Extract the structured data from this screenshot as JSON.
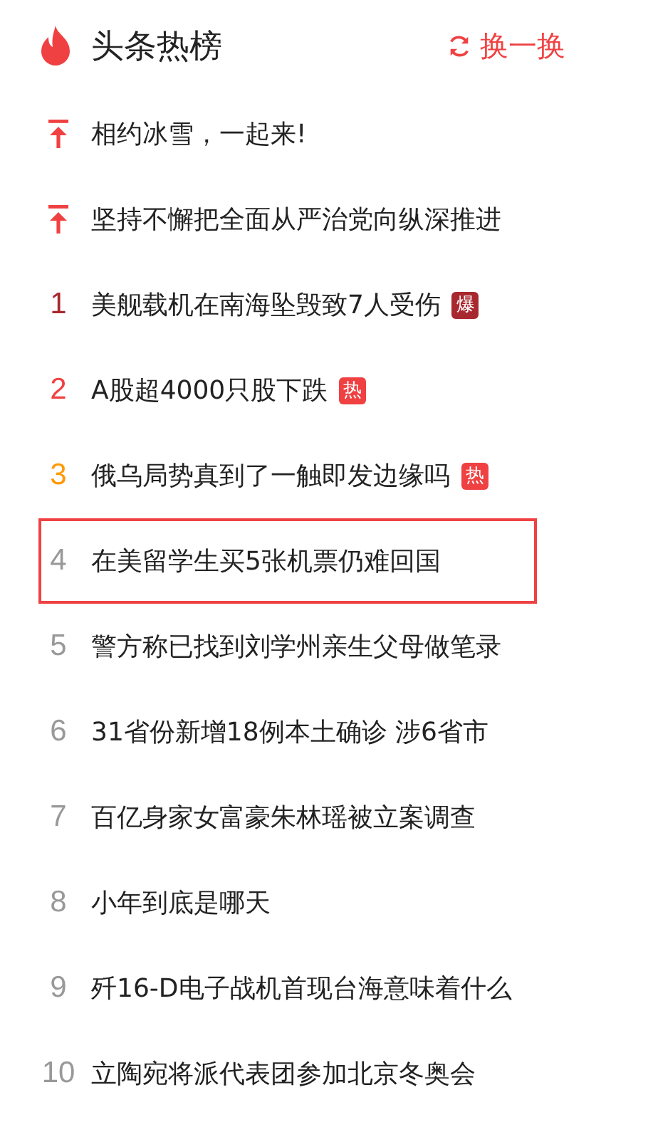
{
  "header": {
    "title": "头条热榜",
    "refresh": "换一换"
  },
  "items": [
    {
      "kind": "pinned",
      "text": "相约冰雪，一起来!",
      "selected": false
    },
    {
      "kind": "pinned",
      "text": "坚持不懈把全面从严治党向纵深推进",
      "selected": false
    },
    {
      "kind": "ranked",
      "rank": "1",
      "color": "#a8282f",
      "text": "美舰载机在南海坠毁致7人受伤",
      "badge": {
        "text": "爆",
        "color": "#a8282f"
      },
      "selected": false
    },
    {
      "kind": "ranked",
      "rank": "2",
      "color": "#f04142",
      "text": "A股超4000只股下跌",
      "badge": {
        "text": "热",
        "color": "#f04142"
      },
      "selected": false
    },
    {
      "kind": "ranked",
      "rank": "3",
      "color": "#fe9900",
      "text": "俄乌局势真到了一触即发边缘吗",
      "badge": {
        "text": "热",
        "color": "#f04142"
      },
      "selected": false
    },
    {
      "kind": "ranked",
      "rank": "4",
      "color": "#999999",
      "text": "在美留学生买5张机票仍难回国",
      "selected": true
    },
    {
      "kind": "ranked",
      "rank": "5",
      "color": "#999999",
      "text": "警方称已找到刘学州亲生父母做笔录",
      "selected": false
    },
    {
      "kind": "ranked",
      "rank": "6",
      "color": "#999999",
      "text": "31省份新增18例本土确诊 涉6省市",
      "selected": false
    },
    {
      "kind": "ranked",
      "rank": "7",
      "color": "#999999",
      "text": "百亿身家女富豪朱林瑶被立案调查",
      "selected": false
    },
    {
      "kind": "ranked",
      "rank": "8",
      "color": "#999999",
      "text": "小年到底是哪天",
      "selected": false
    },
    {
      "kind": "ranked",
      "rank": "9",
      "color": "#999999",
      "text": "歼16-D电子战机首现台海意味着什么",
      "selected": false
    },
    {
      "kind": "ranked",
      "rank": "10",
      "color": "#999999",
      "text": "立陶宛将派代表团参加北京冬奥会",
      "selected": false
    }
  ]
}
